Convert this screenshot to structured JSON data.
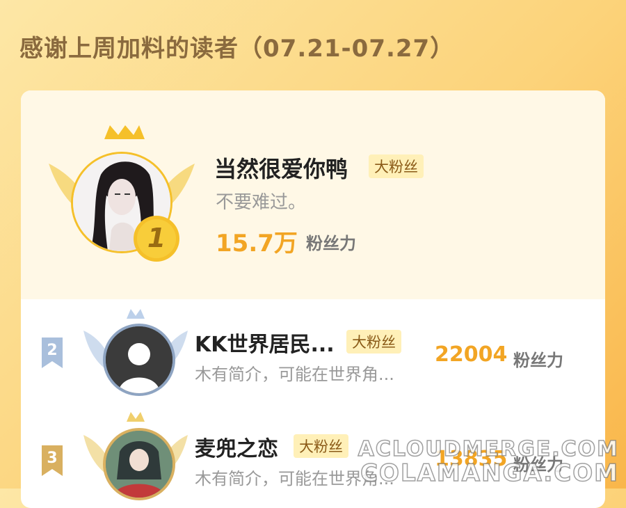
{
  "header": {
    "title": "感谢上周加料的读者（07.21-07.27）"
  },
  "rankings": [
    {
      "rank": "1",
      "name": "当然很爱你鸭",
      "badge": "大粉丝",
      "bio": "不要难过。",
      "value": "15.7万",
      "unit": "粉丝力"
    },
    {
      "rank": "2",
      "name": "KK世界居民...",
      "badge": "大粉丝",
      "bio": "木有简介，可能在世界角...",
      "value": "22004",
      "unit": "粉丝力"
    },
    {
      "rank": "3",
      "name": "麦兜之恋",
      "badge": "大粉丝",
      "bio": "木有简介，可能在世界角...",
      "value": "13835",
      "unit": "粉丝力"
    }
  ],
  "watermark": {
    "line1": "ACLOUDMERGE.COM",
    "line2": "COLAMANGA.COM"
  },
  "colors": {
    "accent": "#f2a524",
    "gold": "#f5c02a",
    "silver": "#a9bfdc",
    "bronze": "#d9b060"
  }
}
